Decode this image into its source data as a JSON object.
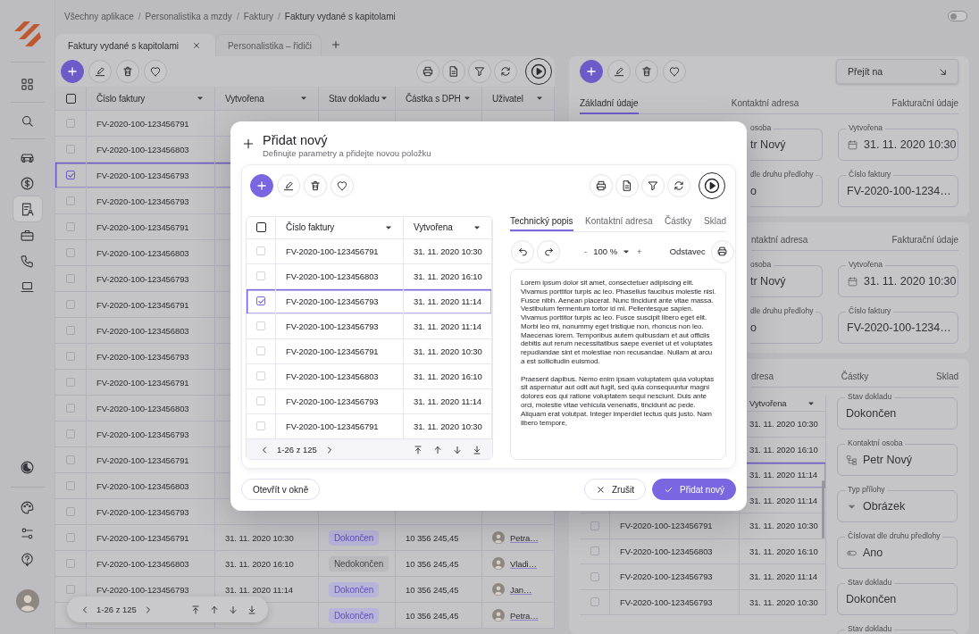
{
  "sidebar": {
    "groups": [
      [
        {
          "kind": "grid",
          "selected": false
        }
      ],
      [
        {
          "kind": "search",
          "selected": false
        }
      ],
      [
        {
          "kind": "car",
          "selected": false
        },
        {
          "kind": "dollar",
          "selected": false
        },
        {
          "kind": "invoice",
          "selected": true
        },
        {
          "kind": "briefcase",
          "selected": false
        },
        {
          "kind": "phone",
          "selected": false
        },
        {
          "kind": "laptop",
          "selected": false
        }
      ]
    ],
    "bottom_groups": [
      [
        {
          "kind": "theme"
        }
      ],
      [
        {
          "kind": "palette"
        },
        {
          "kind": "sliders"
        },
        {
          "kind": "help"
        }
      ]
    ]
  },
  "breadcrumb": [
    {
      "kind": "link",
      "text": "Všechny aplikace"
    },
    {
      "kind": "separator",
      "text": "/"
    },
    {
      "kind": "link",
      "text": "Personalistika a mzdy"
    },
    {
      "kind": "separator",
      "text": "/"
    },
    {
      "kind": "link",
      "text": "Faktury"
    },
    {
      "kind": "separator",
      "text": "/"
    },
    {
      "kind": "current",
      "text": "Faktury vydané s kapitolami"
    }
  ],
  "mode_switch": {
    "on": false
  },
  "tabs": [
    {
      "label": "Faktury vydané s kapitolami",
      "selected": true,
      "closable": true
    },
    {
      "label": "Personalistika – řidiči",
      "selected": false,
      "closable": false
    }
  ],
  "main_table": {
    "columns": [
      "Číslo faktury",
      "Vytvořena",
      "Stav dokladu",
      "Částka s DPH",
      "Uživatel"
    ],
    "all_selected": false,
    "rows": [
      {
        "selected": false,
        "number": "FV-2020-100-123456791"
      },
      {
        "selected": false,
        "number": "FV-2020-100-123456803"
      },
      {
        "selected": true,
        "number": "FV-2020-100-123456793"
      },
      {
        "selected": false,
        "number": "FV-2020-100-123456793"
      },
      {
        "selected": false,
        "number": "FV-2020-100-123456791"
      },
      {
        "selected": false,
        "number": "FV-2020-100-123456803"
      },
      {
        "selected": false,
        "number": "FV-2020-100-123456793"
      },
      {
        "selected": false,
        "number": "FV-2020-100-123456791"
      },
      {
        "selected": false,
        "number": "FV-2020-100-123456803"
      },
      {
        "selected": false,
        "number": "FV-2020-100-123456793"
      },
      {
        "selected": false,
        "number": "FV-2020-100-123456791"
      },
      {
        "selected": false,
        "number": "FV-2020-100-123456803"
      },
      {
        "selected": false,
        "number": "FV-2020-100-123456793"
      },
      {
        "selected": false,
        "number": "FV-2020-100-123456791"
      },
      {
        "selected": false,
        "number": "FV-2020-100-123456803"
      },
      {
        "selected": false,
        "number": "FV-2020-100-123456793"
      },
      {
        "selected": false,
        "number": "FV-2020-100-123456791",
        "created": "31. 11. 2020 10:30",
        "status": "Dokončen",
        "status_done": true,
        "amount": "10 356 245,45",
        "user": "Petra…"
      },
      {
        "selected": false,
        "number": "FV-2020-100-123456803",
        "created": "31. 11. 2020 16:10",
        "status": "Nedokončen",
        "status_done": false,
        "amount": "10 356 245,45",
        "user": "Vladi…"
      },
      {
        "selected": false,
        "number": "FV-2020-100-123456793",
        "created": "31. 11. 2020 11:14",
        "status": "Dokončen",
        "status_done": true,
        "amount": "10 356 245,45",
        "user": "Jan…"
      },
      {
        "selected": false,
        "status": "Dokončen",
        "status_done": true,
        "amount": "10 356 245,45",
        "user": "Petra…"
      }
    ],
    "pager": "1-26 z 125"
  },
  "detail": {
    "goto_button": "Přejít na",
    "cards": [
      {
        "kind": "top",
        "tabs": [
          {
            "label": "Základní údaje",
            "selected": true
          },
          {
            "label": "Kontaktní adresa",
            "selected": false
          },
          {
            "label": "Fakturační údaje",
            "selected": false
          }
        ],
        "fields": [
          {
            "kind": "text",
            "label": "osoba",
            "value": "tr Nový"
          },
          {
            "kind": "date",
            "label": "Vytvořena",
            "value": "31. 11. 2020 10:30"
          },
          {
            "kind": "text",
            "label": "dle druhu předlohy",
            "value": "o"
          },
          {
            "kind": "text",
            "label": "Číslo faktury",
            "value": "FV-2020-100-1234…"
          }
        ]
      },
      {
        "kind": "form",
        "tabs": [
          {
            "label": "ntaktní adresa",
            "selected": false
          },
          {
            "label": "Fakturační údaje",
            "selected": false
          }
        ],
        "fields": [
          {
            "kind": "text",
            "label": "osoba",
            "value": "tr Nový"
          },
          {
            "kind": "date",
            "label": "Vytvořena",
            "value": "31. 11. 2020 10:30"
          },
          {
            "kind": "text",
            "label": "dle druhu předlohy",
            "value": "o"
          },
          {
            "kind": "text",
            "label": "Číslo faktury",
            "value": "FV-2020-100-1234…"
          }
        ]
      },
      {
        "kind": "table",
        "tabs": [
          {
            "label": "dresa",
            "selected": false
          },
          {
            "label": "Částky",
            "selected": false
          },
          {
            "label": "Sklad",
            "selected": false
          }
        ],
        "table": {
          "header": "Vytvořena",
          "rows": [
            {
              "selected": false,
              "created": "31. 11. 2020 10:30"
            },
            {
              "selected": false,
              "created": "31. 11. 2020 16:10"
            },
            {
              "selected": true,
              "created": "31. 11. 2020 11:14"
            },
            {
              "selected": false,
              "created": "31. 11. 2020 11:14"
            },
            {
              "selected": false,
              "number": "FV-2020-100-123456791",
              "created": "31. 11. 2020 10:30"
            },
            {
              "selected": false,
              "number": "FV-2020-100-123456803",
              "created": "31. 11. 2020 16:10"
            },
            {
              "selected": false,
              "number": "FV-2020-100-123456793",
              "created": "31. 11. 2020 11:14"
            },
            {
              "selected": false,
              "number": "FV-2020-100-123456793",
              "created": "31. 11. 2020 10:30"
            }
          ]
        },
        "fields": [
          {
            "kind": "text",
            "label": "Stav dokladu",
            "value": "Dokončen"
          },
          {
            "kind": "person",
            "label": "Kontaktní osoba",
            "value": "Petr Nový"
          },
          {
            "kind": "select",
            "label": "Typ přílohy",
            "value": "Obrázek"
          },
          {
            "kind": "toggle",
            "label": "Číslovat dle druhu předlohy",
            "value": "Ano"
          },
          {
            "kind": "text",
            "label": "Stav dokladu",
            "value": "Dokončen"
          },
          {
            "kind": "text",
            "label": "Stav dokladu"
          }
        ]
      }
    ]
  },
  "dialog": {
    "title": "Přidat nový",
    "subtitle": "Definujte parametry a přidejte novou položku",
    "table": {
      "columns": [
        "Číslo faktury",
        "Vytvořena"
      ],
      "all_selected": false,
      "rows": [
        {
          "selected": false,
          "number": "FV-2020-100-123456791",
          "created": "31. 11. 2020 10:30"
        },
        {
          "selected": false,
          "number": "FV-2020-100-123456803",
          "created": "31. 11. 2020 16:10"
        },
        {
          "selected": true,
          "number": "FV-2020-100-123456793",
          "created": "31. 11. 2020 11:14"
        },
        {
          "selected": false,
          "number": "FV-2020-100-123456793",
          "created": "31. 11. 2020 11:14"
        },
        {
          "selected": false,
          "number": "FV-2020-100-123456791",
          "created": "31. 11. 2020 10:30"
        },
        {
          "selected": false,
          "number": "FV-2020-100-123456803",
          "created": "31. 11. 2020 16:10"
        },
        {
          "selected": false,
          "number": "FV-2020-100-123456793",
          "created": "31. 11. 2020 11:14"
        },
        {
          "selected": false,
          "number": "FV-2020-100-123456791",
          "created": "31. 11. 2020 10:30"
        }
      ],
      "pager": "1-26 z 125"
    },
    "editor": {
      "tabs": [
        {
          "label": "Technický popis",
          "selected": true
        },
        {
          "label": "Kontaktní adresa",
          "selected": false
        },
        {
          "label": "Částky",
          "selected": false
        },
        {
          "label": "Sklad",
          "selected": false
        }
      ],
      "zoom_out": "-",
      "zoom": "100 %",
      "zoom_in": "+",
      "style": "Odstavec",
      "paragraphs": [
        "Lorem ipsum dolor sit amet, consectetuer adipiscing elit. Vivamus porttitor turpis ac leo. Phasellus faucibus molestie nisl. Fusce nibh. Aenean placerat. Nunc tincidunt ante vitae massa. Vestibulum fermentum tortor id mi. Pellentesque sapien. Vivamus porttitor turpis ac leo. Fusce suscipit libero eget elit. Morbi leo mi, nonummy eget tristique non, rhoncus non leo. Maecenas lorem. Temporibus autem quibusdam et aut officiis debitis aut rerum necessitatibus saepe eveniet ut et voluptates repudiandae sint et molestiae non recusandae. Nullam at arcu a est sollicitudin euismod.",
        "Praesent dapibus. Nemo enim ipsam voluptatem quia voluptas sit aspernatur aut odit aut fugit, sed quia consequuntur magni dolores eos qui ratione voluptatem sequi nesciunt. Duis ante orci, molestie vitae vehicula venenatis, tincidunt ac pede. Aliquam erat volutpat. Integer imperdiet lectus quis justo. Nam libero tempore,"
      ]
    },
    "open_button": "Otevřít v okně",
    "cancel_button": "Zrušit",
    "confirm_button": "Přidat nový"
  }
}
